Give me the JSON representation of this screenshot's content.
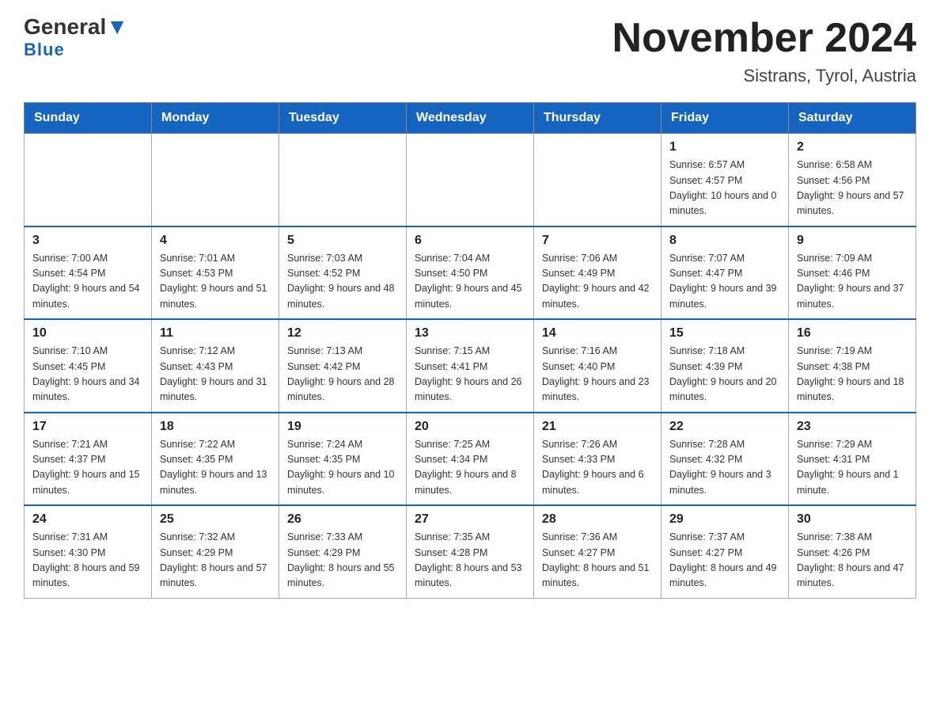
{
  "header": {
    "logo_main": "General",
    "logo_accent": "Blue",
    "title": "November 2024",
    "subtitle": "Sistrans, Tyrol, Austria"
  },
  "days_of_week": [
    "Sunday",
    "Monday",
    "Tuesday",
    "Wednesday",
    "Thursday",
    "Friday",
    "Saturday"
  ],
  "weeks": [
    {
      "days": [
        {
          "num": "",
          "info": ""
        },
        {
          "num": "",
          "info": ""
        },
        {
          "num": "",
          "info": ""
        },
        {
          "num": "",
          "info": ""
        },
        {
          "num": "",
          "info": ""
        },
        {
          "num": "1",
          "info": "Sunrise: 6:57 AM\nSunset: 4:57 PM\nDaylight: 10 hours and 0 minutes."
        },
        {
          "num": "2",
          "info": "Sunrise: 6:58 AM\nSunset: 4:56 PM\nDaylight: 9 hours and 57 minutes."
        }
      ]
    },
    {
      "days": [
        {
          "num": "3",
          "info": "Sunrise: 7:00 AM\nSunset: 4:54 PM\nDaylight: 9 hours and 54 minutes."
        },
        {
          "num": "4",
          "info": "Sunrise: 7:01 AM\nSunset: 4:53 PM\nDaylight: 9 hours and 51 minutes."
        },
        {
          "num": "5",
          "info": "Sunrise: 7:03 AM\nSunset: 4:52 PM\nDaylight: 9 hours and 48 minutes."
        },
        {
          "num": "6",
          "info": "Sunrise: 7:04 AM\nSunset: 4:50 PM\nDaylight: 9 hours and 45 minutes."
        },
        {
          "num": "7",
          "info": "Sunrise: 7:06 AM\nSunset: 4:49 PM\nDaylight: 9 hours and 42 minutes."
        },
        {
          "num": "8",
          "info": "Sunrise: 7:07 AM\nSunset: 4:47 PM\nDaylight: 9 hours and 39 minutes."
        },
        {
          "num": "9",
          "info": "Sunrise: 7:09 AM\nSunset: 4:46 PM\nDaylight: 9 hours and 37 minutes."
        }
      ]
    },
    {
      "days": [
        {
          "num": "10",
          "info": "Sunrise: 7:10 AM\nSunset: 4:45 PM\nDaylight: 9 hours and 34 minutes."
        },
        {
          "num": "11",
          "info": "Sunrise: 7:12 AM\nSunset: 4:43 PM\nDaylight: 9 hours and 31 minutes."
        },
        {
          "num": "12",
          "info": "Sunrise: 7:13 AM\nSunset: 4:42 PM\nDaylight: 9 hours and 28 minutes."
        },
        {
          "num": "13",
          "info": "Sunrise: 7:15 AM\nSunset: 4:41 PM\nDaylight: 9 hours and 26 minutes."
        },
        {
          "num": "14",
          "info": "Sunrise: 7:16 AM\nSunset: 4:40 PM\nDaylight: 9 hours and 23 minutes."
        },
        {
          "num": "15",
          "info": "Sunrise: 7:18 AM\nSunset: 4:39 PM\nDaylight: 9 hours and 20 minutes."
        },
        {
          "num": "16",
          "info": "Sunrise: 7:19 AM\nSunset: 4:38 PM\nDaylight: 9 hours and 18 minutes."
        }
      ]
    },
    {
      "days": [
        {
          "num": "17",
          "info": "Sunrise: 7:21 AM\nSunset: 4:37 PM\nDaylight: 9 hours and 15 minutes."
        },
        {
          "num": "18",
          "info": "Sunrise: 7:22 AM\nSunset: 4:35 PM\nDaylight: 9 hours and 13 minutes."
        },
        {
          "num": "19",
          "info": "Sunrise: 7:24 AM\nSunset: 4:35 PM\nDaylight: 9 hours and 10 minutes."
        },
        {
          "num": "20",
          "info": "Sunrise: 7:25 AM\nSunset: 4:34 PM\nDaylight: 9 hours and 8 minutes."
        },
        {
          "num": "21",
          "info": "Sunrise: 7:26 AM\nSunset: 4:33 PM\nDaylight: 9 hours and 6 minutes."
        },
        {
          "num": "22",
          "info": "Sunrise: 7:28 AM\nSunset: 4:32 PM\nDaylight: 9 hours and 3 minutes."
        },
        {
          "num": "23",
          "info": "Sunrise: 7:29 AM\nSunset: 4:31 PM\nDaylight: 9 hours and 1 minute."
        }
      ]
    },
    {
      "days": [
        {
          "num": "24",
          "info": "Sunrise: 7:31 AM\nSunset: 4:30 PM\nDaylight: 8 hours and 59 minutes."
        },
        {
          "num": "25",
          "info": "Sunrise: 7:32 AM\nSunset: 4:29 PM\nDaylight: 8 hours and 57 minutes."
        },
        {
          "num": "26",
          "info": "Sunrise: 7:33 AM\nSunset: 4:29 PM\nDaylight: 8 hours and 55 minutes."
        },
        {
          "num": "27",
          "info": "Sunrise: 7:35 AM\nSunset: 4:28 PM\nDaylight: 8 hours and 53 minutes."
        },
        {
          "num": "28",
          "info": "Sunrise: 7:36 AM\nSunset: 4:27 PM\nDaylight: 8 hours and 51 minutes."
        },
        {
          "num": "29",
          "info": "Sunrise: 7:37 AM\nSunset: 4:27 PM\nDaylight: 8 hours and 49 minutes."
        },
        {
          "num": "30",
          "info": "Sunrise: 7:38 AM\nSunset: 4:26 PM\nDaylight: 8 hours and 47 minutes."
        }
      ]
    }
  ]
}
